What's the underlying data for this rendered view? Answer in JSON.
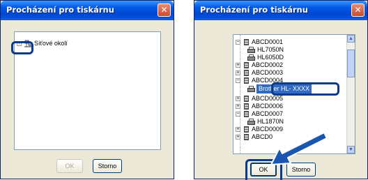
{
  "left_dialog": {
    "title": "Procházení pro tiskárnu",
    "tree_items": [
      {
        "label": "Síťové okolí",
        "expander": "+",
        "icon": "network-icon"
      }
    ],
    "ok_label": "OK",
    "cancel_label": "Storno"
  },
  "right_dialog": {
    "title": "Procházení pro tiskárnu",
    "tree_items": [
      {
        "label": "ABCD0001",
        "expander": "−",
        "icon": "server-icon"
      },
      {
        "label": "HL7050N",
        "icon": "printer-icon"
      },
      {
        "label": "HL6050D",
        "icon": "printer-icon"
      },
      {
        "label": "ABCD0002",
        "expander": "+",
        "icon": "server-icon"
      },
      {
        "label": "ABCD0003",
        "expander": "+",
        "icon": "server-icon"
      },
      {
        "label": "ABCD0004",
        "expander": "−",
        "icon": "server-icon"
      },
      {
        "label": "Brother HL- XXXX",
        "icon": "printer-icon",
        "selected": true
      },
      {
        "label": "ABCD0005",
        "expander": "+",
        "icon": "server-icon"
      },
      {
        "label": "ABCD0006",
        "expander": "+",
        "icon": "server-icon"
      },
      {
        "label": "ABCD0007",
        "expander": "−",
        "icon": "server-icon"
      },
      {
        "label": "HL1870N",
        "icon": "printer-icon"
      },
      {
        "label": "ABCD0009",
        "expander": "+",
        "icon": "server-icon"
      },
      {
        "label": "ABCD0",
        "expander": "+",
        "icon": "server-icon"
      }
    ],
    "ok_label": "OK",
    "cancel_label": "Storno"
  },
  "colors": {
    "titlebar": "#0054e3",
    "callout": "#0b3a8a",
    "arrow": "#1a56b0",
    "dialog_bg": "#ece9d8"
  }
}
